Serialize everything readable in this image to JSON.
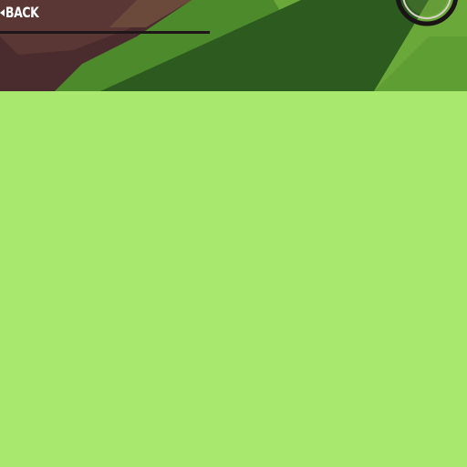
{
  "header": {
    "back_label": "BACK"
  },
  "colors": {
    "content_background": "#a9e86e",
    "header_grass_light": "#5c9a30",
    "header_grass_dark": "#2f5a20",
    "header_rock": "#4a2d2d",
    "text": "#ffffff"
  },
  "icons": {
    "back": "chevron-left-icon",
    "wheel": "bicycle-wheel-icon"
  }
}
